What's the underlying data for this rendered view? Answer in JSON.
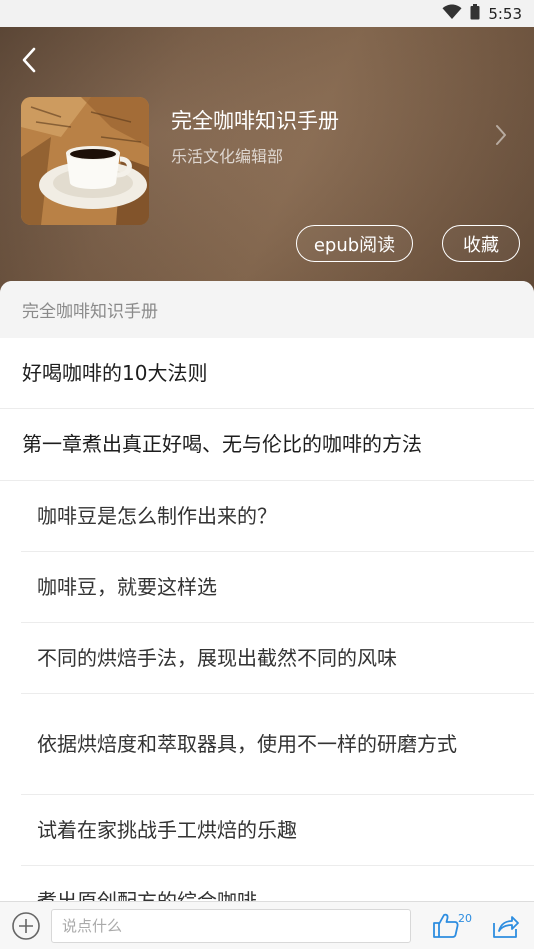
{
  "status_bar": {
    "time": "5:53"
  },
  "book": {
    "title": "完全咖啡知识手册",
    "author": "乐活文化编辑部",
    "actions": {
      "epub_read": "epub阅读",
      "favorite": "收藏"
    }
  },
  "toc": {
    "header": "完全咖啡知识手册",
    "items": [
      {
        "label": "好喝咖啡的10大法则",
        "level": 1
      },
      {
        "label": "第一章煮出真正好喝、无与伦比的咖啡的方法",
        "level": 1
      },
      {
        "label": "咖啡豆是怎么制作出来的？",
        "level": 2
      },
      {
        "label": "咖啡豆，就要这样选",
        "level": 2
      },
      {
        "label": "不同的烘焙手法，展现出截然不同的风味",
        "level": 2
      },
      {
        "label": "依据烘焙度和萃取器具，使用不一样的研磨方式",
        "level": 2
      },
      {
        "label": "试着在家挑战手工烘焙的乐趣",
        "level": 2
      },
      {
        "label": "煮出原创配方的综合咖啡",
        "level": 2
      }
    ]
  },
  "bottom_bar": {
    "comment_placeholder": "说点什么",
    "like_count": "20"
  },
  "colors": {
    "accent": "#2d8de0"
  },
  "icons": [
    "wifi-icon",
    "battery-icon",
    "back-arrow-icon",
    "chevron-right-icon",
    "plus-icon",
    "thumbs-up-icon",
    "share-icon"
  ]
}
